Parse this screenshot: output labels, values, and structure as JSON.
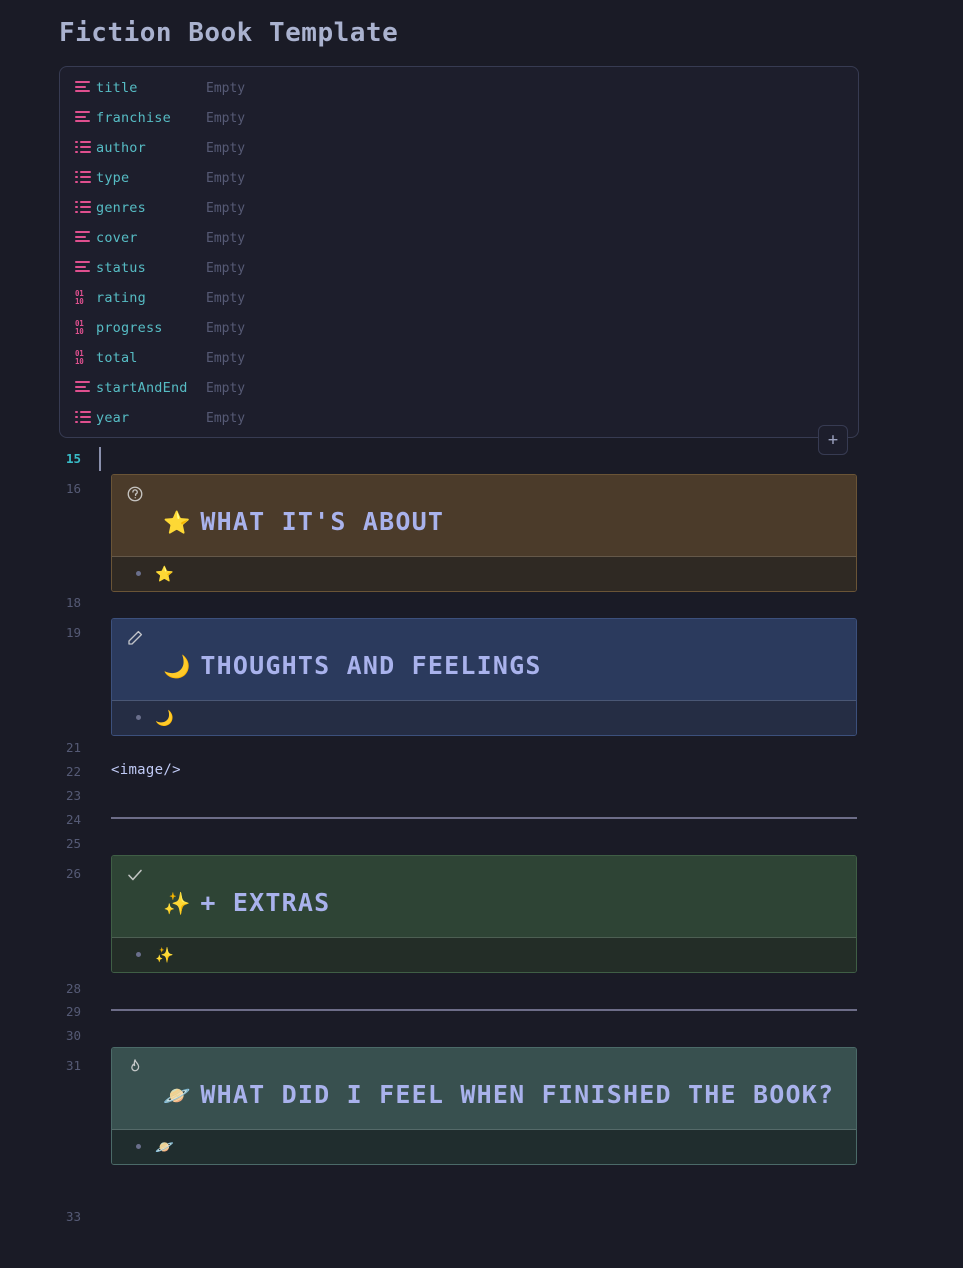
{
  "page": {
    "title": "Fiction Book Template",
    "theme_background": "#1a1b26",
    "heading_color": "#a9b2ec",
    "accent_property_icon": "#e0508f",
    "accent_property_key": "#56bcc4"
  },
  "properties": {
    "add_button_label": "+",
    "empty_value_label": "Empty",
    "rows": [
      {
        "key": "title",
        "value": "Empty",
        "type": "text"
      },
      {
        "key": "franchise",
        "value": "Empty",
        "type": "text"
      },
      {
        "key": "author",
        "value": "Empty",
        "type": "list"
      },
      {
        "key": "type",
        "value": "Empty",
        "type": "list"
      },
      {
        "key": "genres",
        "value": "Empty",
        "type": "list"
      },
      {
        "key": "cover",
        "value": "Empty",
        "type": "text"
      },
      {
        "key": "status",
        "value": "Empty",
        "type": "text"
      },
      {
        "key": "rating",
        "value": "Empty",
        "type": "number"
      },
      {
        "key": "progress",
        "value": "Empty",
        "type": "number"
      },
      {
        "key": "total",
        "value": "Empty",
        "type": "number"
      },
      {
        "key": "startAndEnd",
        "value": "Empty",
        "type": "text"
      },
      {
        "key": "year",
        "value": "Empty",
        "type": "list"
      }
    ]
  },
  "editor": {
    "line_numbers": [
      "15",
      "16",
      "18",
      "19",
      "21",
      "22",
      "23",
      "24",
      "25",
      "26",
      "28",
      "29",
      "30",
      "31",
      "33"
    ],
    "active_line": "15",
    "plain_text_line": "<image/>",
    "callouts": [
      {
        "type": "question",
        "type_icon": "question-circle-icon",
        "emoji": "⭐",
        "heading": "WHAT IT'S ABOUT",
        "body_emoji": "⭐",
        "header_color": "#4b3b2a",
        "body_color": "#2f2923"
      },
      {
        "type": "note",
        "type_icon": "pencil-icon",
        "emoji": "🌙",
        "heading": "THOUGHTS AND FEELINGS",
        "body_emoji": "🌙",
        "header_color": "#2b3a5d",
        "body_color": "#252d44"
      },
      {
        "type": "success",
        "type_icon": "check-icon",
        "emoji": "✨",
        "heading": "+ EXTRAS",
        "body_emoji": "✨",
        "header_color": "#2e4435",
        "body_color": "#232d27"
      },
      {
        "type": "tip",
        "type_icon": "flame-icon",
        "emoji": "🪐",
        "heading": "WHAT DID I FEEL WHEN FINISHED THE BOOK?",
        "body_emoji": "🪐",
        "header_color": "#38504f",
        "body_color": "#202d2e"
      }
    ]
  }
}
